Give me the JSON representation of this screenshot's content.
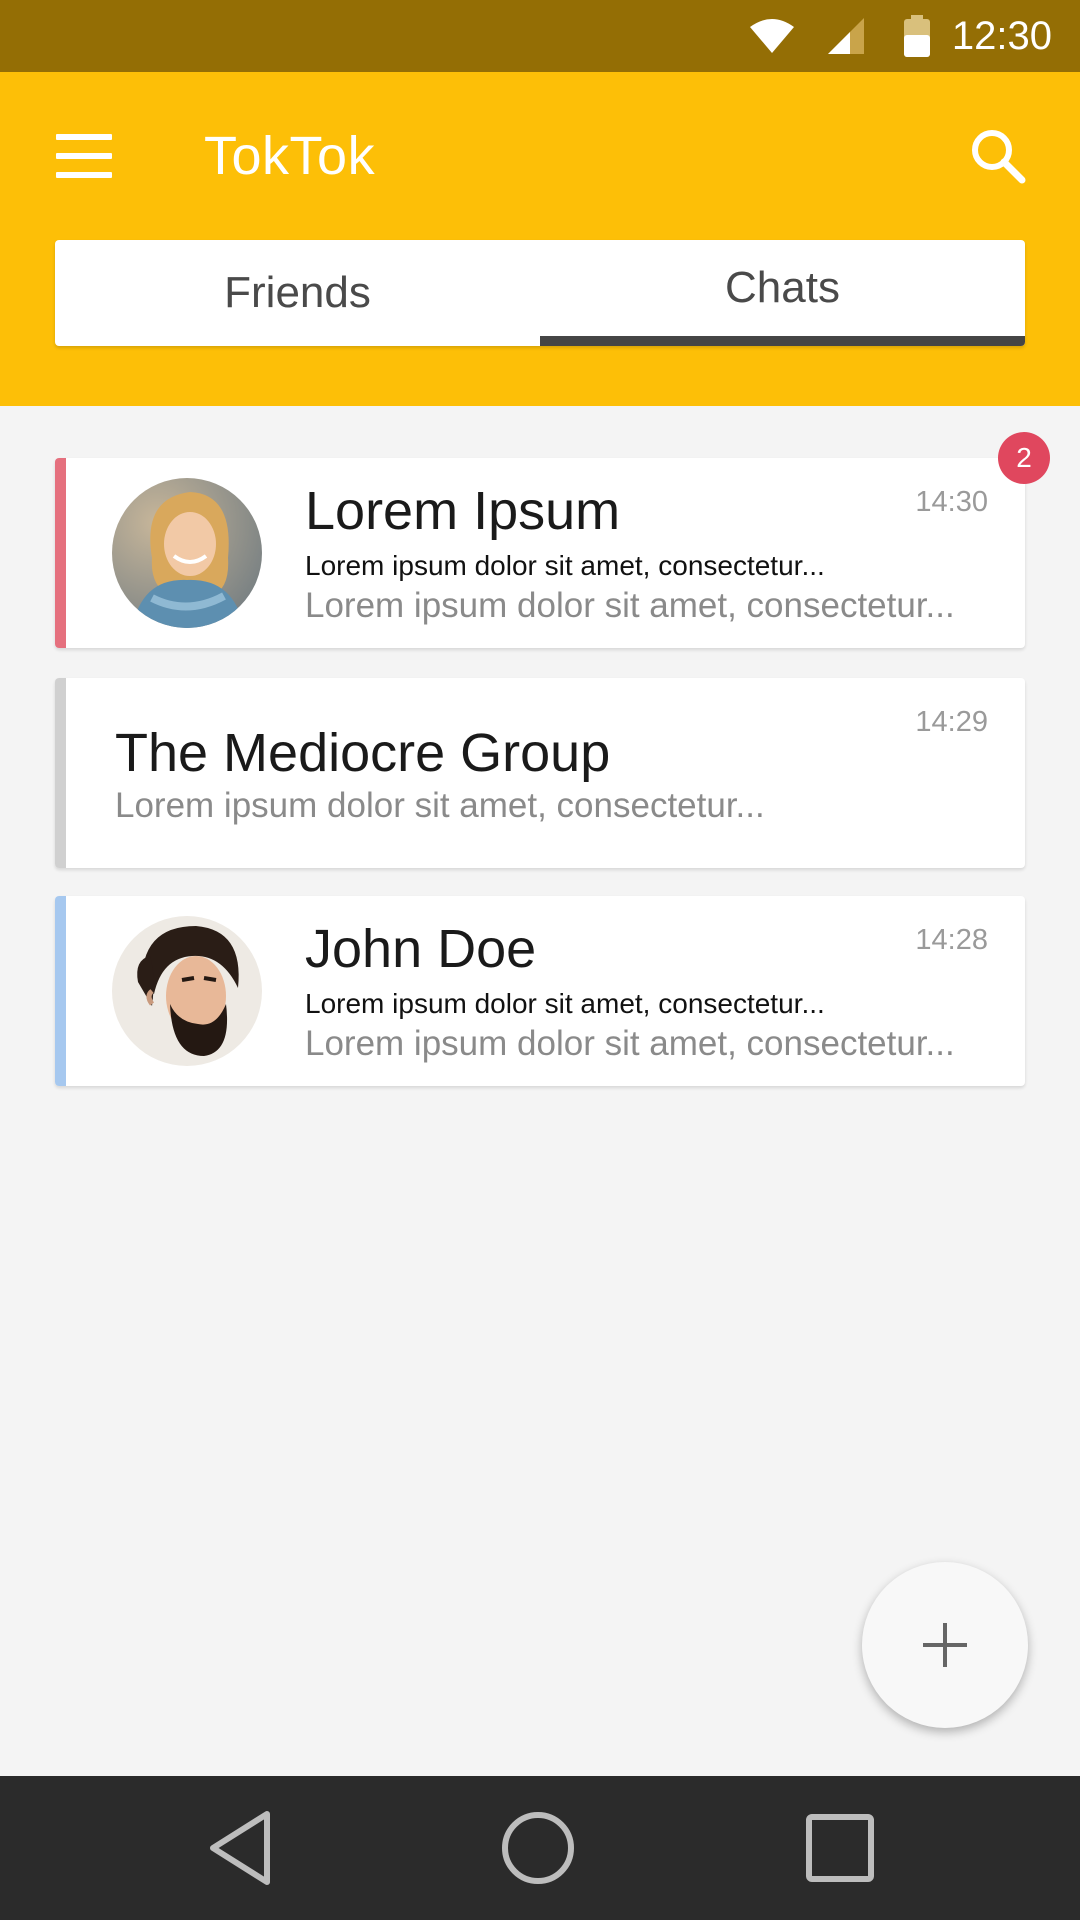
{
  "status_bar": {
    "time": "12:30",
    "icons": [
      "wifi-icon",
      "cell-signal-icon",
      "battery-icon"
    ],
    "background_color": "#946e05"
  },
  "app_bar": {
    "title": "TokTok",
    "menu_icon": "hamburger-menu-icon",
    "search_icon": "search-icon",
    "background_color": "#fdbf07"
  },
  "tabs": {
    "items": [
      {
        "label": "Friends",
        "selected": false
      },
      {
        "label": "Chats",
        "selected": true
      }
    ],
    "indicator_color": "#454545"
  },
  "chats": [
    {
      "name": "Lorem Ipsum",
      "preview_line1": "Lorem ipsum dolor sit amet, consectetur...",
      "preview_line2": "Lorem ipsum dolor sit amet, consectetur...",
      "timestamp": "14:30",
      "unread": "2",
      "accent_color": "#e5707e",
      "avatar": "woman-avatar"
    },
    {
      "name": "The Mediocre Group",
      "preview_line1": "Lorem ipsum dolor sit amet, consectetur...",
      "timestamp": "14:29",
      "accent_color": "#d0d0d0"
    },
    {
      "name": "John Doe",
      "preview_line1": "Lorem ipsum dolor sit amet, consectetur...",
      "preview_line2": "Lorem ipsum dolor sit amet, consectetur...",
      "timestamp": "14:28",
      "accent_color": "#a6c8ef",
      "avatar": "bearded-man-avatar"
    }
  ],
  "fab": {
    "icon": "plus-icon"
  },
  "nav_bar": {
    "buttons": [
      "back-icon",
      "home-icon",
      "recents-icon"
    ],
    "background_color": "#2b2b2b"
  }
}
